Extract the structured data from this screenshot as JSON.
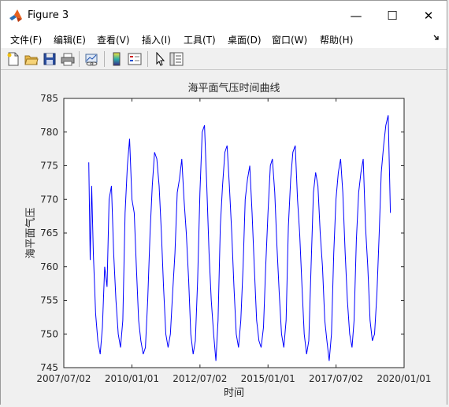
{
  "window": {
    "title": "Figure 3",
    "controls": {
      "minimize": "—",
      "maximize": "☐",
      "close": "✕"
    }
  },
  "menu": {
    "items": [
      "文件(F)",
      "编辑(E)",
      "查看(V)",
      "插入(I)",
      "工具(T)",
      "桌面(D)",
      "窗口(W)",
      "帮助(H)"
    ],
    "overflow_icon": "dock-arrow-icon"
  },
  "toolbar": {
    "icons": [
      "new-figure-icon",
      "open-file-icon",
      "save-icon",
      "print-icon",
      "link-plot-icon",
      "colorbar-icon",
      "legend-icon",
      "pointer-icon",
      "property-inspector-icon"
    ]
  },
  "chart_data": {
    "type": "line",
    "title": "海平面气压时间曲线",
    "xlabel": "时间",
    "ylabel": "海平面气压",
    "x_tick_labels": [
      "2007/07/02",
      "2010/01/01",
      "2012/07/02",
      "2015/01/01",
      "2017/07/02",
      "2020/01/01"
    ],
    "x_tick_dates": [
      "2007-07-02",
      "2010-01-01",
      "2012-07-02",
      "2015-01-01",
      "2017-07-02",
      "2020-01-01"
    ],
    "ylim": [
      745,
      785
    ],
    "y_ticks": [
      745,
      750,
      755,
      760,
      765,
      770,
      775,
      780,
      785
    ],
    "line_color": "#0000ff",
    "grid": false,
    "series": [
      {
        "x": [
          "2008-06-01",
          "2008-06-20",
          "2008-07-10",
          "2008-08-01",
          "2008-09-01",
          "2008-10-01",
          "2008-11-01",
          "2008-12-01",
          "2009-01-01",
          "2009-02-01",
          "2009-03-01",
          "2009-04-01",
          "2009-05-01",
          "2009-06-01",
          "2009-07-01",
          "2009-08-01",
          "2009-09-01",
          "2009-10-01",
          "2009-11-01",
          "2009-12-01",
          "2010-01-01",
          "2010-02-01",
          "2010-03-01",
          "2010-04-01",
          "2010-05-01",
          "2010-06-01",
          "2010-07-01",
          "2010-08-01",
          "2010-09-01",
          "2010-10-01",
          "2010-11-01",
          "2010-12-01",
          "2011-01-01",
          "2011-02-01",
          "2011-03-01",
          "2011-04-01",
          "2011-05-01",
          "2011-06-01",
          "2011-07-01",
          "2011-08-01",
          "2011-09-01",
          "2011-10-01",
          "2011-11-01",
          "2011-12-01",
          "2012-01-01",
          "2012-02-01",
          "2012-03-01",
          "2012-04-01",
          "2012-05-01",
          "2012-06-01",
          "2012-07-01",
          "2012-08-01",
          "2012-09-01",
          "2012-10-01",
          "2012-11-01",
          "2012-12-01",
          "2013-01-01",
          "2013-02-01",
          "2013-03-01",
          "2013-04-01",
          "2013-05-01",
          "2013-06-01",
          "2013-07-01",
          "2013-08-01",
          "2013-09-01",
          "2013-10-01",
          "2013-11-01",
          "2013-12-01",
          "2014-01-01",
          "2014-02-01",
          "2014-03-01",
          "2014-04-01",
          "2014-05-01",
          "2014-06-01",
          "2014-07-01",
          "2014-08-01",
          "2014-09-01",
          "2014-10-01",
          "2014-11-01",
          "2014-12-01",
          "2015-01-01",
          "2015-02-01",
          "2015-03-01",
          "2015-04-01",
          "2015-05-01",
          "2015-06-01",
          "2015-07-01",
          "2015-08-01",
          "2015-09-01",
          "2015-10-01",
          "2015-11-01",
          "2015-12-01",
          "2016-01-01",
          "2016-02-01",
          "2016-03-01",
          "2016-04-01",
          "2016-05-01",
          "2016-06-01",
          "2016-07-01",
          "2016-08-01",
          "2016-09-01",
          "2016-10-01",
          "2016-11-01",
          "2016-12-01",
          "2017-01-01",
          "2017-02-01",
          "2017-03-01",
          "2017-04-01",
          "2017-05-01",
          "2017-06-01",
          "2017-07-01",
          "2017-08-01",
          "2017-09-01",
          "2017-10-01",
          "2017-11-01",
          "2017-12-01",
          "2018-01-01",
          "2018-02-01",
          "2018-03-01",
          "2018-04-01",
          "2018-05-01",
          "2018-06-01",
          "2018-07-01",
          "2018-08-01",
          "2018-09-01",
          "2018-10-01",
          "2018-11-01",
          "2018-12-01",
          "2019-01-01",
          "2019-02-01",
          "2019-03-01",
          "2019-04-01",
          "2019-05-01",
          "2019-06-01",
          "2019-07-01"
        ],
        "y": [
          775.5,
          761,
          772,
          762,
          753,
          749,
          747,
          751,
          760,
          757,
          770,
          772,
          762,
          755,
          750,
          748,
          752,
          768,
          775,
          779,
          770,
          768,
          760,
          752,
          749,
          747,
          748,
          755,
          765,
          772,
          777,
          776,
          772,
          765,
          757,
          750,
          748,
          750,
          756,
          762,
          771,
          773,
          776,
          770,
          765,
          758,
          750,
          747,
          749,
          758,
          771,
          780,
          781,
          772,
          762,
          755,
          750,
          746,
          752,
          766,
          772,
          777,
          778,
          772,
          765,
          757,
          750,
          748,
          752,
          760,
          770,
          773,
          775,
          768,
          760,
          752,
          749,
          748,
          751,
          760,
          768,
          775,
          776,
          771,
          763,
          756,
          750,
          748,
          752,
          766,
          773,
          777,
          778,
          770,
          765,
          757,
          750,
          747,
          749,
          760,
          771,
          774,
          772,
          765,
          760,
          752,
          749,
          746,
          750,
          762,
          770,
          774,
          776,
          771,
          762,
          755,
          750,
          748,
          752,
          764,
          771,
          774,
          776,
          766,
          760,
          752,
          749,
          750,
          756,
          765,
          774,
          778,
          781,
          782.5,
          768
        ]
      }
    ]
  }
}
